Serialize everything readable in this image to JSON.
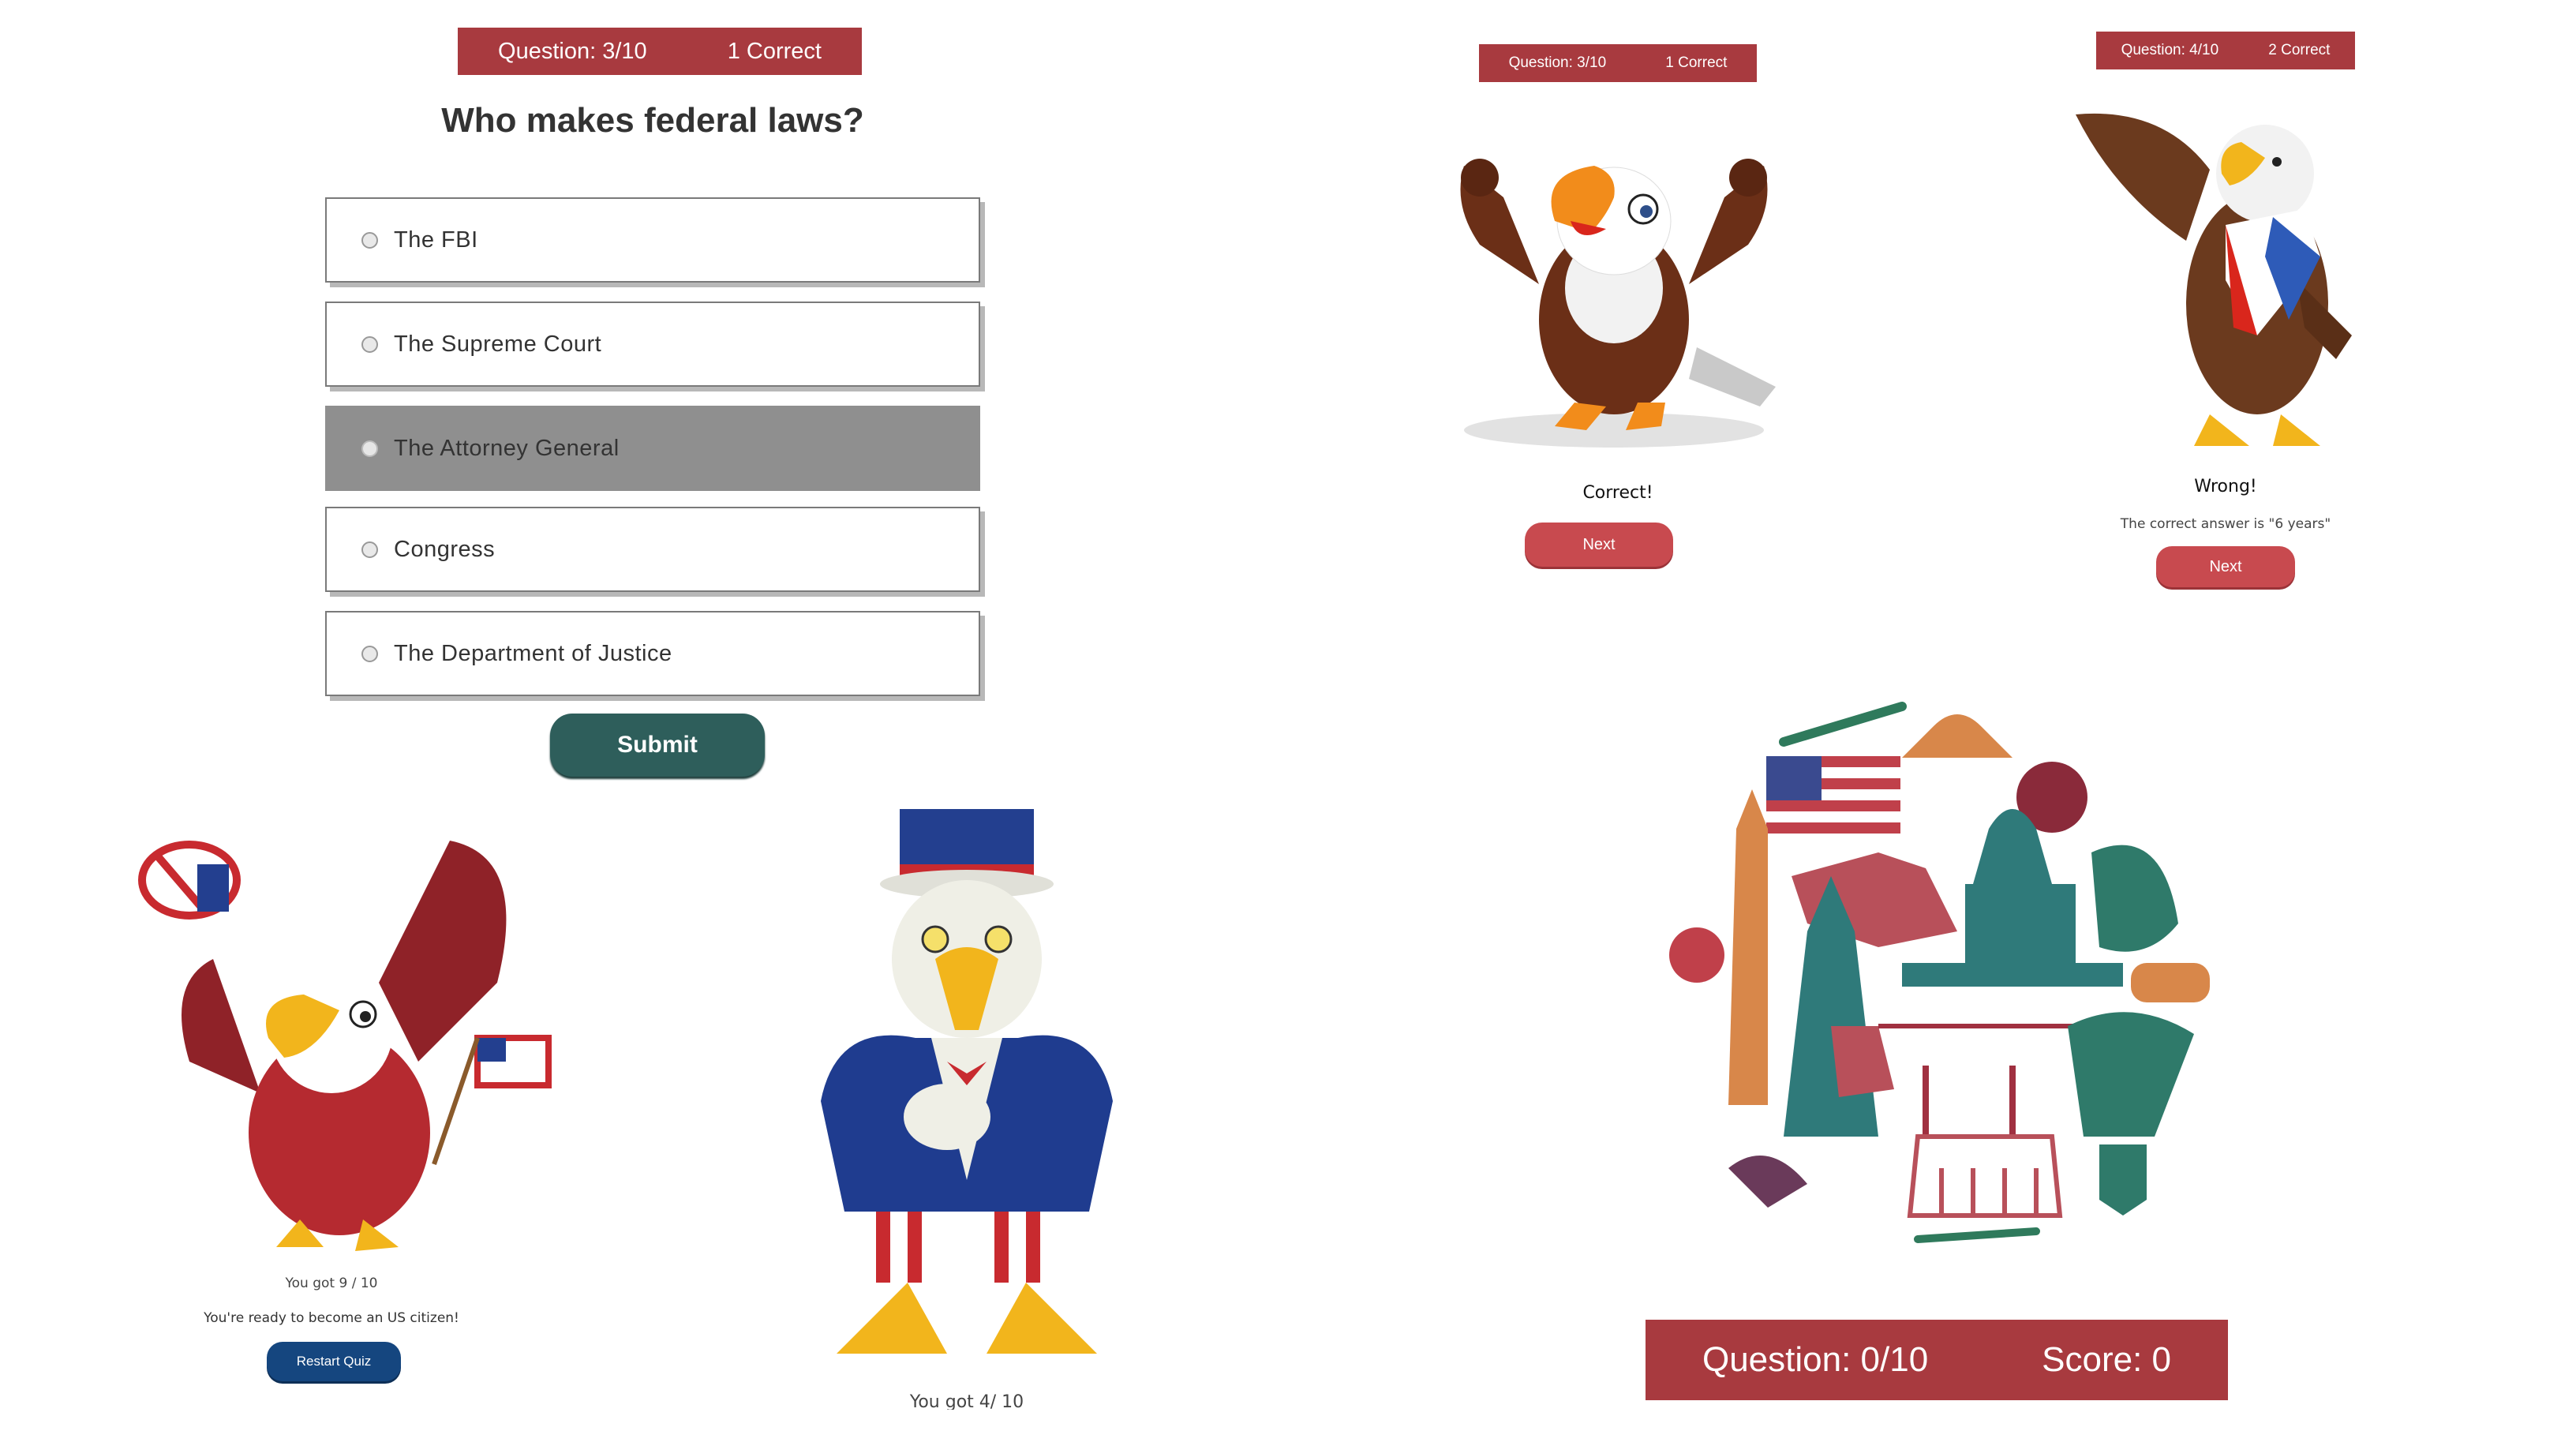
{
  "quiz": {
    "status_question": "Question: 3/10",
    "status_correct": "1 Correct",
    "question": "Who makes federal laws?",
    "options": [
      {
        "label": "The FBI"
      },
      {
        "label": "The Supreme Court"
      },
      {
        "label": "The Attorney General"
      },
      {
        "label": "Congress"
      },
      {
        "label": "The Department of Justice"
      }
    ],
    "highlighted_option": "The Attorney General",
    "submit_label": "Submit"
  },
  "correct_screen": {
    "status_question": "Question: 3/10",
    "status_correct": "1 Correct",
    "message": "Correct!",
    "next_label": "Next"
  },
  "wrong_screen": {
    "status_question": "Question: 4/10",
    "status_correct": "2 Correct",
    "message": "Wrong!",
    "detail": "The correct answer is \"6 years\"",
    "next_label": "Next"
  },
  "result_screen": {
    "score_text": "You got 9 / 10",
    "message": "You're ready to become an US citizen!",
    "restart_label": "Restart Quiz"
  },
  "result_screen_2": {
    "score_text": "You got 4/ 10"
  },
  "start_screen": {
    "status_question": "Question: 0/10",
    "status_score": "Score: 0"
  },
  "colors": {
    "header_red": "#a83a3f",
    "button_red": "#c84a4f",
    "submit_teal": "#2e5e5b",
    "restart_blue": "#15467f",
    "option_highlight": "#8f8f8f"
  },
  "icons": [
    "eagle-thumbs-up-illustration",
    "eagle-flag-tie-illustration",
    "eagle-uncle-sam-hat-flag-illustration",
    "eagle-uncle-sam-pointing-illustration",
    "usa-icons-collage"
  ]
}
